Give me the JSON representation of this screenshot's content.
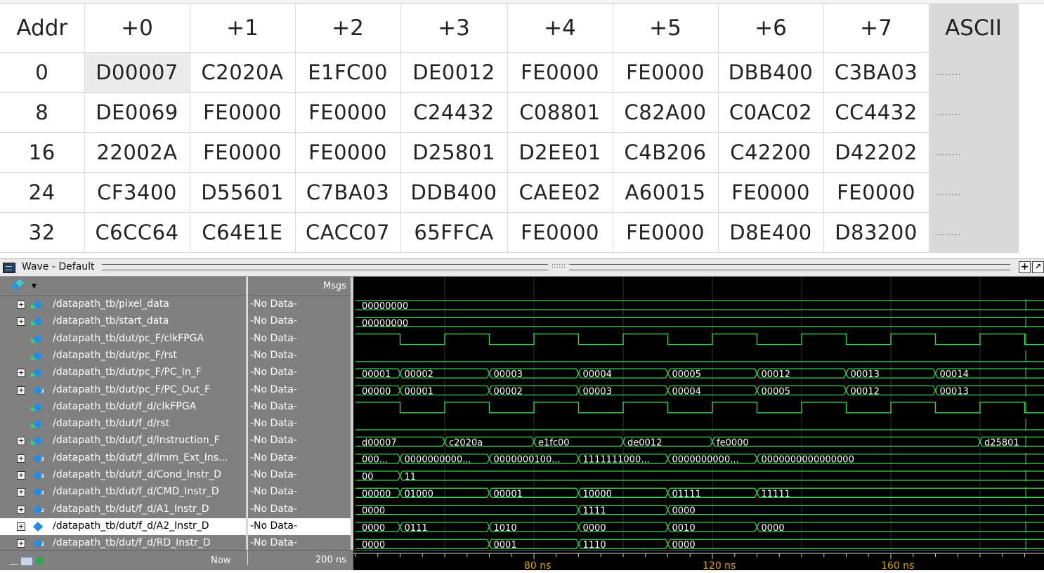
{
  "memory_table": {
    "headers": [
      "Addr",
      "+0",
      "+1",
      "+2",
      "+3",
      "+4",
      "+5",
      "+6",
      "+7",
      "ASCII"
    ],
    "rows": [
      {
        "addr": "0",
        "cells": [
          "D00007",
          "C2020A",
          "E1FC00",
          "DE0012",
          "FE0000",
          "FE0000",
          "DBB400",
          "C3BA03"
        ],
        "ascii": "........"
      },
      {
        "addr": "8",
        "cells": [
          "DE0069",
          "FE0000",
          "FE0000",
          "C24432",
          "C08801",
          "C82A00",
          "C0AC02",
          "CC4432"
        ],
        "ascii": "........"
      },
      {
        "addr": "16",
        "cells": [
          "22002A",
          "FE0000",
          "FE0000",
          "D25801",
          "D2EE01",
          "C4B206",
          "C42200",
          "D42202"
        ],
        "ascii": "........"
      },
      {
        "addr": "24",
        "cells": [
          "CF3400",
          "D55601",
          "C7BA03",
          "DDB400",
          "CAEE02",
          "A60015",
          "FE0000",
          "FE0000"
        ],
        "ascii": "........"
      },
      {
        "addr": "32",
        "cells": [
          "C6CC64",
          "C64E1E",
          "CACC07",
          "65FFCA",
          "FE0000",
          "FE0000",
          "D8E400",
          "D83200"
        ],
        "ascii": "........"
      }
    ]
  },
  "wave_window": {
    "title": "Wave - Default",
    "msgs_header": "Msgs",
    "add_button_label": "+",
    "undock_button_label": "↗",
    "grip_label": "::::::",
    "now_label": "Now",
    "now_value": "200 ns",
    "signals": [
      {
        "name": "/datapath_tb/pixel_data",
        "msg": "-No Data-",
        "expandable": true,
        "kind": "in"
      },
      {
        "name": "/datapath_tb/start_data",
        "msg": "-No Data-",
        "expandable": true,
        "kind": "in"
      },
      {
        "name": "/datapath_tb/dut/pc_F/clkFPGA",
        "msg": "-No Data-",
        "expandable": false,
        "kind": "in"
      },
      {
        "name": "/datapath_tb/dut/pc_F/rst",
        "msg": "-No Data-",
        "expandable": false,
        "kind": "in"
      },
      {
        "name": "/datapath_tb/dut/pc_F/PC_In_F",
        "msg": "-No Data-",
        "expandable": true,
        "kind": "in"
      },
      {
        "name": "/datapath_tb/dut/pc_F/PC_Out_F",
        "msg": "-No Data-",
        "expandable": true,
        "kind": "out"
      },
      {
        "name": "/datapath_tb/dut/f_d/clkFPGA",
        "msg": "-No Data-",
        "expandable": false,
        "kind": "in"
      },
      {
        "name": "/datapath_tb/dut/f_d/rst",
        "msg": "-No Data-",
        "expandable": false,
        "kind": "in"
      },
      {
        "name": "/datapath_tb/dut/f_d/Instruction_F",
        "msg": "-No Data-",
        "expandable": true,
        "kind": "in"
      },
      {
        "name": "/datapath_tb/dut/f_d/Imm_Ext_Ins...",
        "msg": "-No Data-",
        "expandable": true,
        "kind": "out"
      },
      {
        "name": "/datapath_tb/dut/f_d/Cond_Instr_D",
        "msg": "-No Data-",
        "expandable": true,
        "kind": "out"
      },
      {
        "name": "/datapath_tb/dut/f_d/CMD_Instr_D",
        "msg": "-No Data-",
        "expandable": true,
        "kind": "out"
      },
      {
        "name": "/datapath_tb/dut/f_d/A1_Instr_D",
        "msg": "-No Data-",
        "expandable": true,
        "kind": "out"
      },
      {
        "name": "/datapath_tb/dut/f_d/A2_Instr_D",
        "msg": "-No Data-",
        "expandable": true,
        "kind": "out",
        "selected": true
      },
      {
        "name": "/datapath_tb/dut/f_d/RD_Instr_D",
        "msg": "-No Data-",
        "expandable": true,
        "kind": "out"
      }
    ],
    "wave_values": {
      "pixel_data": [
        "00000000"
      ],
      "start_data": [
        "00000000"
      ],
      "PC_In_F": [
        "00001",
        "00002",
        "00003",
        "00004",
        "00005",
        "00012",
        "00013",
        "00014"
      ],
      "PC_Out_F": [
        "00000",
        "00001",
        "00002",
        "00003",
        "00004",
        "00005",
        "00012",
        "00013"
      ],
      "Instruction_F": [
        "d00007",
        "c2020a",
        "e1fc00",
        "de0012",
        "fe0000",
        "d25801"
      ],
      "Imm_Ext": [
        "000...",
        "0000000000...",
        "0000000100...",
        "1111111000...",
        "0000000000...",
        "0000000000000000"
      ],
      "Cond_Instr_D": [
        "00",
        "11"
      ],
      "CMD_Instr_D": [
        "00000",
        "01000",
        "00001",
        "10000",
        "01111",
        "11111"
      ],
      "A1_Instr_D": [
        "0000",
        "1111",
        "0000"
      ],
      "A2_Instr_D": [
        "0000",
        "0111",
        "1010",
        "0000",
        "0010",
        "0000"
      ],
      "RD_Instr_D": [
        "0000",
        "0001",
        "1110",
        "0000"
      ]
    },
    "timeline_labels": [
      "80 ns",
      "120 ns",
      "160 ns"
    ],
    "colors": {
      "wave": "#39d353",
      "background": "#000000",
      "grid": "#2f2f2f",
      "panel": "#808080",
      "timeline_text": "#d9a400"
    }
  }
}
